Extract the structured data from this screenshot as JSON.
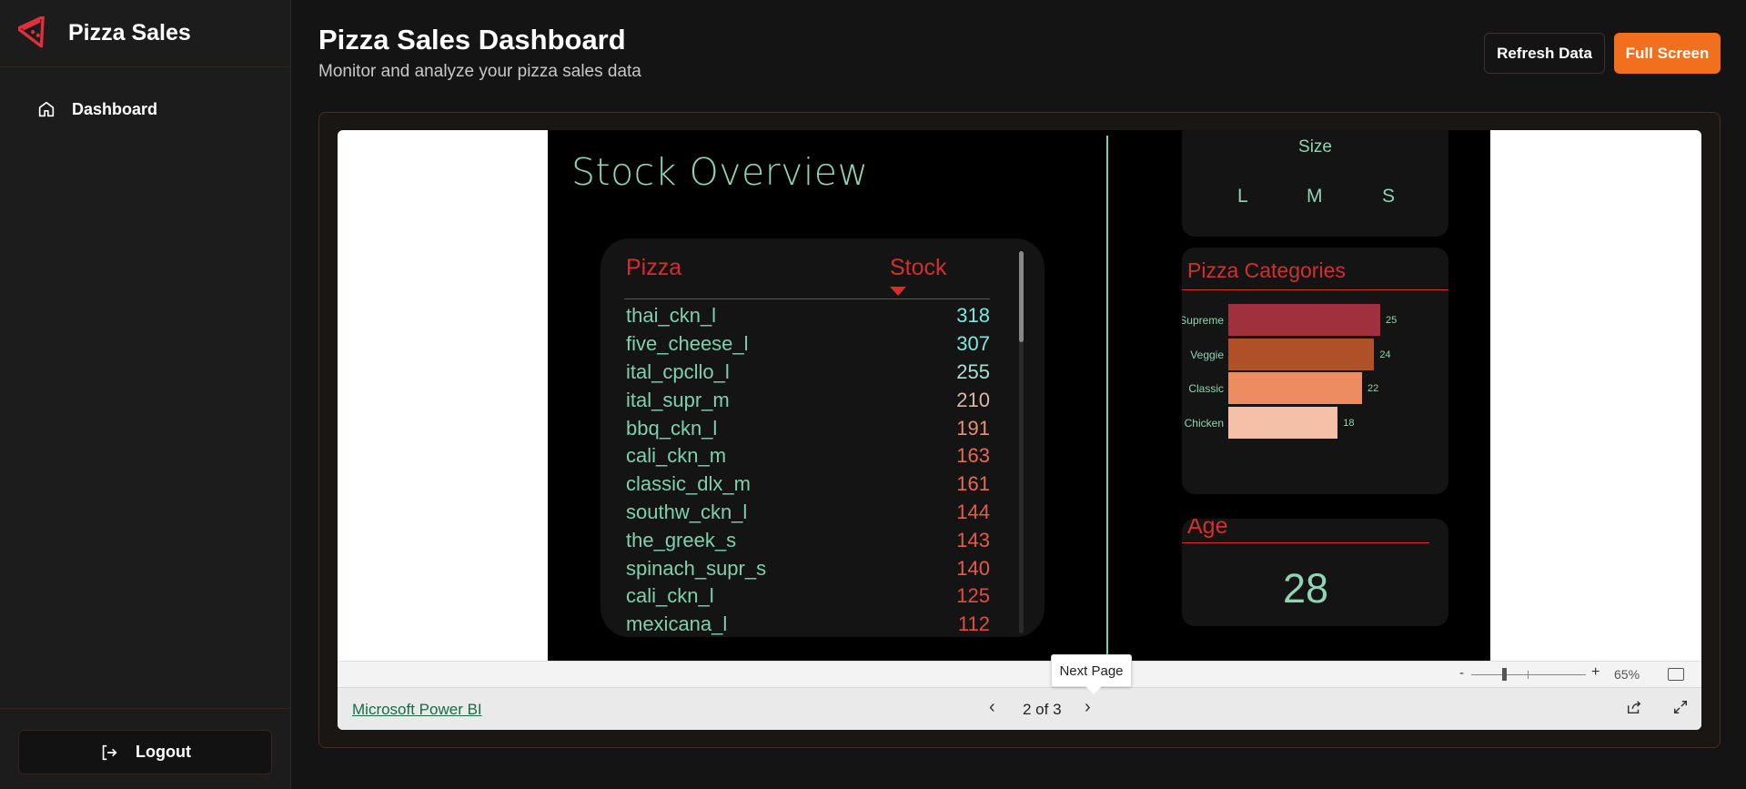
{
  "app": {
    "title": "Pizza Sales"
  },
  "sidebar": {
    "items": [
      {
        "label": "Dashboard",
        "icon": "home-icon"
      }
    ],
    "logout_label": "Logout"
  },
  "header": {
    "title": "Pizza Sales Dashboard",
    "subtitle": "Monitor and analyze your pizza sales data",
    "refresh_label": "Refresh Data",
    "fullscreen_label": "Full Screen"
  },
  "colors": {
    "accent": "#f26f1d",
    "report_green": "#8fd4b4",
    "report_red": "#d32f2f"
  },
  "report": {
    "stock": {
      "title": "Stock Overview",
      "col_pizza": "Pizza",
      "col_stock": "Stock",
      "rows": [
        {
          "name": "thai_ckn_l",
          "stock": "318",
          "color": "#7ee8e0"
        },
        {
          "name": "five_cheese_l",
          "stock": "307",
          "color": "#7ee8e0"
        },
        {
          "name": "ital_cpcllo_l",
          "stock": "255",
          "color": "#a8e0d0"
        },
        {
          "name": "ital_supr_m",
          "stock": "210",
          "color": "#d8b8a0"
        },
        {
          "name": "bbq_ckn_l",
          "stock": "191",
          "color": "#e89070"
        },
        {
          "name": "cali_ckn_m",
          "stock": "163",
          "color": "#e86a50"
        },
        {
          "name": "classic_dlx_m",
          "stock": "161",
          "color": "#e86a50"
        },
        {
          "name": "southw_ckn_l",
          "stock": "144",
          "color": "#e85a48"
        },
        {
          "name": "the_greek_s",
          "stock": "143",
          "color": "#e85a48"
        },
        {
          "name": "spinach_supr_s",
          "stock": "140",
          "color": "#e85a48"
        },
        {
          "name": "cali_ckn_l",
          "stock": "125",
          "color": "#e84a40"
        },
        {
          "name": "mexicana_l",
          "stock": "112",
          "color": "#e84a40"
        }
      ]
    },
    "size": {
      "title": "Size",
      "options": [
        "L",
        "M",
        "S"
      ]
    },
    "categories": {
      "title": "Pizza Categories"
    },
    "age": {
      "title": "Age",
      "value": "28"
    }
  },
  "chart_data": {
    "type": "bar",
    "title": "Pizza Categories",
    "orientation": "horizontal",
    "categories": [
      "Supreme",
      "Veggie",
      "Classic",
      "Chicken"
    ],
    "values": [
      25,
      24,
      22,
      18
    ],
    "colors": [
      "#a0303c",
      "#b05028",
      "#ec8c60",
      "#f4c0a8"
    ],
    "xlim": [
      0,
      25
    ]
  },
  "powerbi": {
    "zoom": {
      "minus": "-",
      "plus": "+",
      "level": "65%"
    },
    "link_label": "Microsoft Power BI",
    "pager": {
      "text": "2 of 3"
    },
    "tooltip": "Next Page"
  }
}
